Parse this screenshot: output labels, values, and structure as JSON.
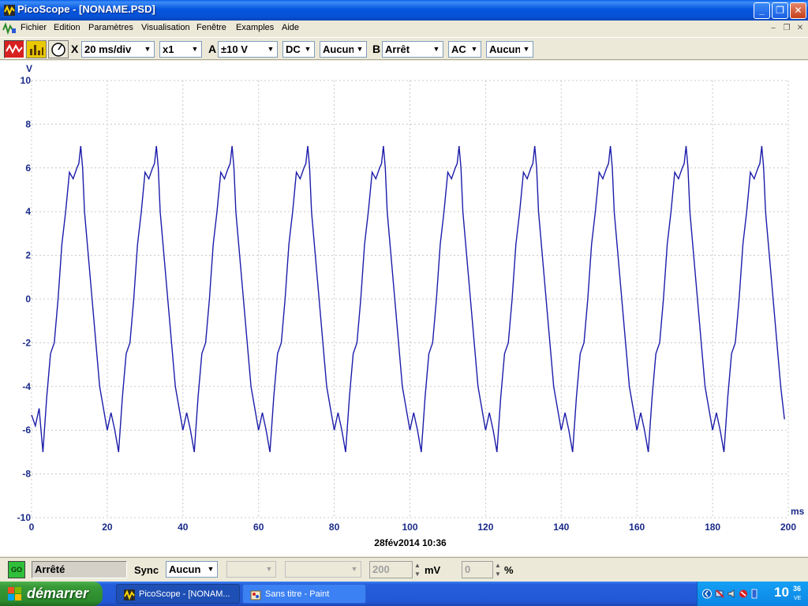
{
  "window": {
    "title": "PicoScope - [NONAME.PSD]",
    "minimize_glyph": "_",
    "restore_glyph": "❐",
    "close_glyph": "✕"
  },
  "menu": {
    "items": [
      "Fichier",
      "Edition",
      "Paramètres",
      "Visualisation",
      "Fenêtre",
      "Examples",
      "Aide"
    ],
    "mdi_glyphs": [
      "–",
      "❐",
      "✕"
    ]
  },
  "toolbar": {
    "icons": [
      "scope-mode-icon",
      "spectrum-mode-icon",
      "meter-mode-icon"
    ],
    "x_label": "X",
    "timebase": "20 ms/div",
    "multiplier": "x1",
    "channel_a_label": "A",
    "channel_a_range": "±10 V",
    "channel_a_coupling": "DC",
    "channel_a_filter": "Aucun",
    "channel_b_label": "B",
    "channel_b_range": "Arrêt",
    "channel_b_coupling": "AC",
    "channel_b_filter": "Aucun",
    "dropdown_glyph": "▼"
  },
  "chart_data": {
    "type": "line",
    "ylabel": "V",
    "xlabel": "ms",
    "xlim": [
      0,
      200
    ],
    "ylim": [
      -10,
      10
    ],
    "x_ticks": [
      0,
      20,
      40,
      60,
      80,
      100,
      120,
      140,
      160,
      180,
      200
    ],
    "y_ticks": [
      10,
      8,
      6,
      4,
      2,
      0,
      -2,
      -4,
      -6,
      -8,
      -10
    ],
    "grid": true,
    "timestamp": "28fév2014  10:36",
    "series": [
      {
        "color": "#1c1caa",
        "x": [
          0,
          1,
          2,
          2.5,
          3,
          4,
          5,
          6,
          7,
          8,
          9,
          10,
          11,
          12,
          12.5,
          13,
          13.5,
          14,
          15,
          16,
          17,
          18,
          19,
          20,
          21,
          22,
          22.5,
          23,
          24,
          25,
          26,
          27,
          28,
          29,
          30,
          31,
          32,
          32.5,
          33,
          33.5,
          34,
          35,
          36,
          37,
          38,
          39,
          40,
          41,
          42,
          42.5,
          43,
          44,
          45,
          46,
          47,
          48,
          49,
          50,
          51,
          52,
          52.5,
          53,
          53.5,
          54,
          55,
          56,
          57,
          58,
          59,
          60,
          61,
          62,
          62.5,
          63,
          64,
          65,
          66,
          67,
          68,
          69,
          70,
          71,
          72,
          72.5,
          73,
          73.5,
          74,
          75,
          76,
          77,
          78,
          79,
          80,
          81,
          82,
          82.5,
          83,
          84,
          85,
          86,
          87,
          88,
          89,
          90,
          91,
          92,
          92.5,
          93,
          93.5,
          94,
          95,
          96,
          97,
          98,
          99,
          100,
          101,
          102,
          102.5,
          103,
          104,
          105,
          106,
          107,
          108,
          109,
          110,
          111,
          112,
          112.5,
          113,
          113.5,
          114,
          115,
          116,
          117,
          118,
          119,
          120,
          121,
          122,
          122.5,
          123,
          124,
          125,
          126,
          127,
          128,
          129,
          130,
          131,
          132,
          132.5,
          133,
          133.5,
          134,
          135,
          136,
          137,
          138,
          139,
          140,
          141,
          142,
          142.5,
          143,
          144,
          145,
          146,
          147,
          148,
          149,
          150,
          151,
          152,
          152.5,
          153,
          153.5,
          154,
          155,
          156,
          157,
          158,
          159,
          160,
          161,
          162,
          162.5,
          163,
          164,
          165,
          166,
          167,
          168,
          169,
          170,
          171,
          172,
          172.5,
          173,
          173.5,
          174,
          175,
          176,
          177,
          178,
          179,
          180,
          181,
          182,
          182.5,
          183,
          184,
          185,
          186,
          187,
          188,
          189,
          190,
          191,
          192,
          192.5,
          193,
          193.5,
          194,
          195,
          196,
          197,
          198,
          199
        ],
        "y": [
          -5.3,
          -5.8,
          -5.0,
          -6.0,
          -7.0,
          -4.5,
          -2.5,
          -2.0,
          0.0,
          2.5,
          4.0,
          5.8,
          5.5,
          6.0,
          6.2,
          7.0,
          6.0,
          4.0,
          2.0,
          0.0,
          -2.0,
          -4.0,
          -5.0,
          -6.0,
          -5.2,
          -6.0,
          -6.5,
          -7.0,
          -4.5,
          -2.5,
          -2.0,
          0.0,
          2.5,
          4.0,
          5.8,
          5.5,
          6.0,
          6.2,
          7.0,
          6.0,
          4.0,
          2.0,
          0.0,
          -2.0,
          -4.0,
          -5.0,
          -6.0,
          -5.2,
          -6.0,
          -6.5,
          -7.0,
          -4.5,
          -2.5,
          -2.0,
          0.0,
          2.5,
          4.0,
          5.8,
          5.5,
          6.0,
          6.2,
          7.0,
          6.0,
          4.0,
          2.0,
          0.0,
          -2.0,
          -4.0,
          -5.0,
          -6.0,
          -5.2,
          -6.0,
          -6.5,
          -7.0,
          -4.5,
          -2.5,
          -2.0,
          0.0,
          2.5,
          4.0,
          5.8,
          5.5,
          6.0,
          6.2,
          7.0,
          6.0,
          4.0,
          2.0,
          0.0,
          -2.0,
          -4.0,
          -5.0,
          -6.0,
          -5.2,
          -6.0,
          -6.5,
          -7.0,
          -4.5,
          -2.5,
          -2.0,
          0.0,
          2.5,
          4.0,
          5.8,
          5.5,
          6.0,
          6.2,
          7.0,
          6.0,
          4.0,
          2.0,
          0.0,
          -2.0,
          -4.0,
          -5.0,
          -6.0,
          -5.2,
          -6.0,
          -6.5,
          -7.0,
          -4.5,
          -2.5,
          -2.0,
          0.0,
          2.5,
          4.0,
          5.8,
          5.5,
          6.0,
          6.2,
          7.0,
          6.0,
          4.0,
          2.0,
          0.0,
          -2.0,
          -4.0,
          -5.0,
          -6.0,
          -5.2,
          -6.0,
          -6.5,
          -7.0,
          -4.5,
          -2.5,
          -2.0,
          0.0,
          2.5,
          4.0,
          5.8,
          5.5,
          6.0,
          6.2,
          7.0,
          6.0,
          4.0,
          2.0,
          0.0,
          -2.0,
          -4.0,
          -5.0,
          -6.0,
          -5.2,
          -6.0,
          -6.5,
          -7.0,
          -4.5,
          -2.5,
          -2.0,
          0.0,
          2.5,
          4.0,
          5.8,
          5.5,
          6.0,
          6.2,
          7.0,
          6.0,
          4.0,
          2.0,
          0.0,
          -2.0,
          -4.0,
          -5.0,
          -6.0,
          -5.2,
          -6.0,
          -6.5,
          -7.0,
          -4.5,
          -2.5,
          -2.0,
          0.0,
          2.5,
          4.0,
          5.8,
          5.5,
          6.0,
          6.2,
          7.0,
          6.0,
          4.0,
          2.0,
          0.0,
          -2.0,
          -4.0,
          -5.0,
          -6.0,
          -5.2,
          -6.0,
          -6.5,
          -7.0,
          -4.5,
          -2.5,
          -2.0,
          0.0,
          2.5,
          4.0,
          5.8,
          5.5,
          6.0,
          6.2,
          7.0,
          6.0,
          4.0,
          2.0,
          0.0,
          -2.0,
          -4.0,
          -5.5
        ]
      }
    ]
  },
  "statusbar": {
    "go_label": "GO",
    "status_text": "Arrêté",
    "sync_label": "Sync",
    "sync_value": "Aucun",
    "level_value": "200",
    "level_unit": "mV",
    "percent_value": "0",
    "percent_unit": "%"
  },
  "taskbar": {
    "start_label": "démarrer",
    "tasks": [
      "PicoScope - [NONAM...",
      "Sans titre - Paint"
    ],
    "clock_hours": "10",
    "clock_minutes": "36",
    "clock_day": "VE"
  },
  "colors": {
    "trace": "#1c1caa",
    "grid": "#c8c8c8",
    "axis_text": "#1a2a8a"
  }
}
